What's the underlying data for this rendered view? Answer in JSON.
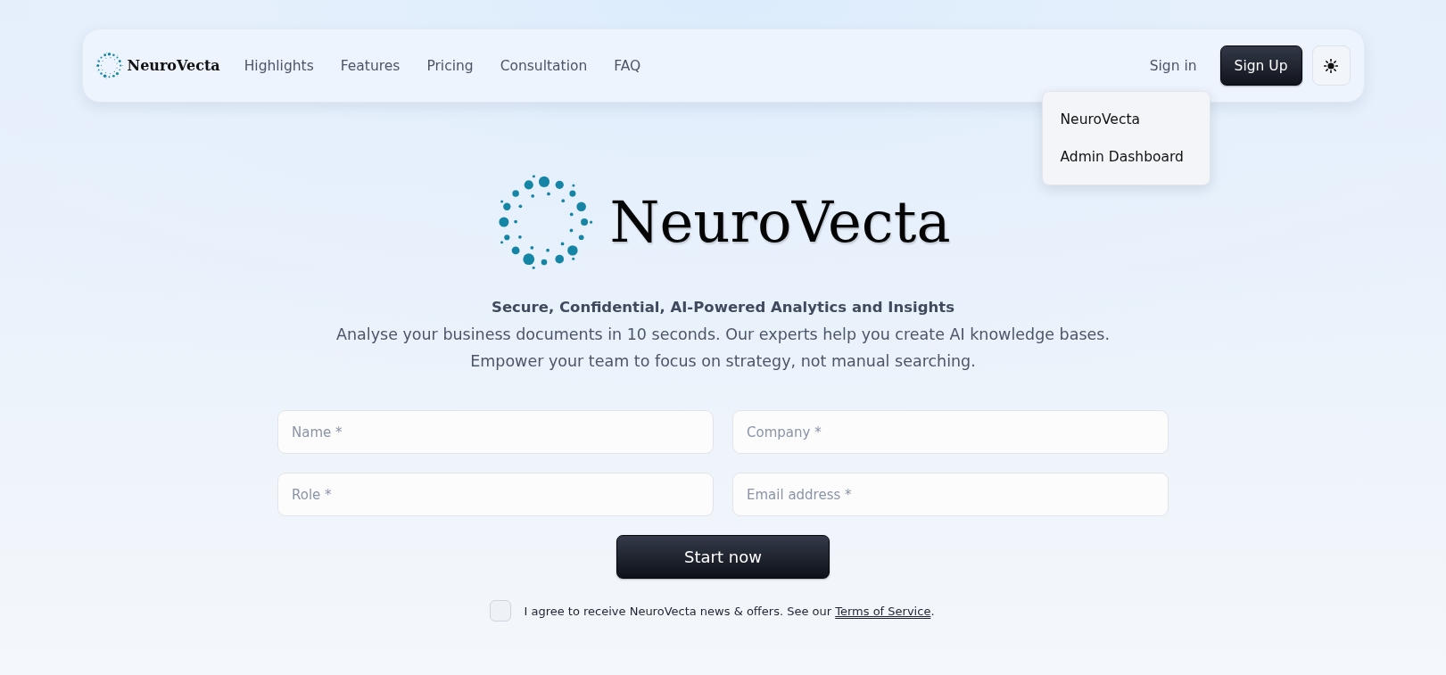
{
  "navbar": {
    "logo_text": "NeuroVecta",
    "links": [
      "Highlights",
      "Features",
      "Pricing",
      "Consultation",
      "FAQ"
    ],
    "sign_in": "Sign in",
    "sign_up": "Sign Up"
  },
  "dropdown": {
    "items": [
      "NeuroVecta",
      "Admin Dashboard"
    ]
  },
  "hero": {
    "brand": "NeuroVecta",
    "tagline": "Secure, Confidential, AI-Powered Analytics and Insights",
    "description": [
      "Analyse your business documents in 10 seconds. Our experts help you create AI knowledge bases.",
      "Empower your team to focus on strategy, not manual searching."
    ]
  },
  "form": {
    "fields": [
      {
        "placeholder": "Name *"
      },
      {
        "placeholder": "Company *"
      },
      {
        "placeholder": "Role *"
      },
      {
        "placeholder": "Email address *"
      }
    ],
    "submit": "Start now",
    "consent": {
      "checked": false,
      "text": "I agree to receive NeuroVecta news & offers. See our ",
      "link": "Terms of Service",
      "end": "."
    }
  }
}
